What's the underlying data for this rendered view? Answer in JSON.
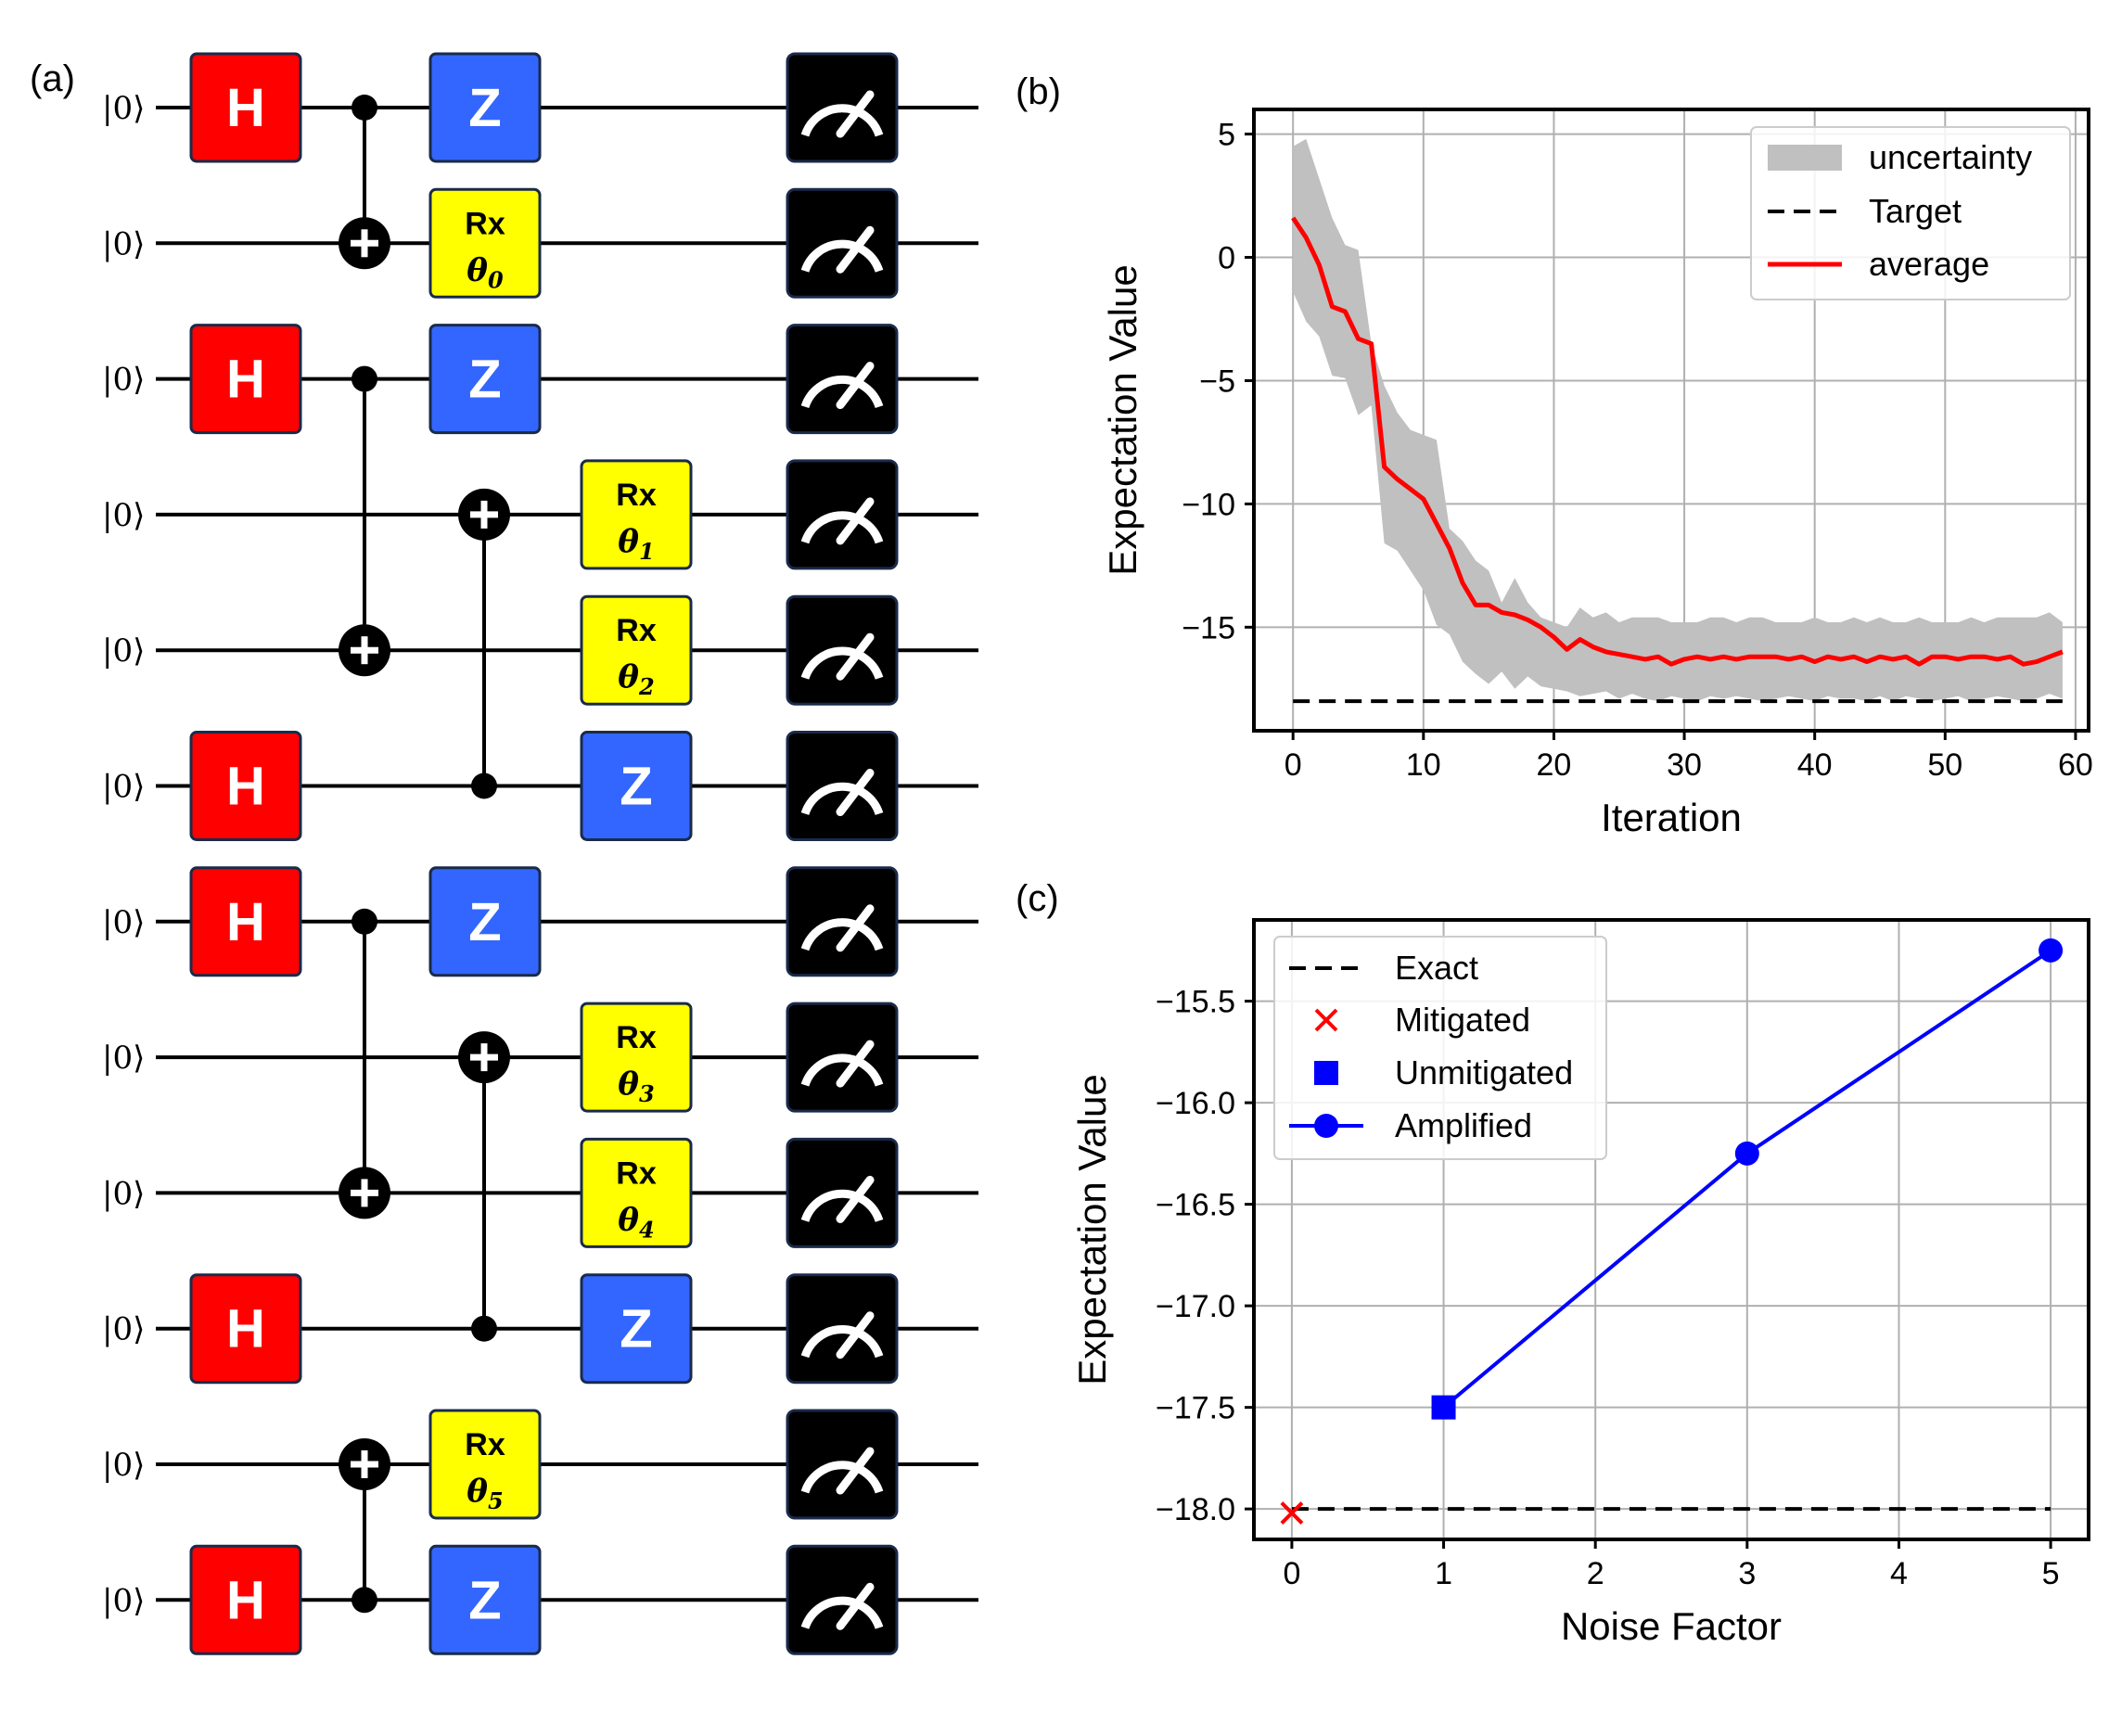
{
  "panels": {
    "a": "(a)",
    "b": "(b)",
    "c": "(c)"
  },
  "colors": {
    "h_gate": "#ff0000",
    "z_gate": "#3366ff",
    "rx_gate": "#ffff00",
    "measure": "#000000",
    "gate_border": "#1a2a4a",
    "uncertainty": "#c0c0c0",
    "average": "#ff0000",
    "target": "#000000",
    "amplified": "#0000ff",
    "mitigated": "#ff0000",
    "unmitigated": "#0000ff"
  },
  "circuit": {
    "ket_label": "|0⟩",
    "qubits": 12,
    "h_label": "H",
    "z_label": "Z",
    "rx_label": "Rx",
    "theta_symbol": "θ",
    "theta_indices": [
      "0",
      "1",
      "2",
      "3",
      "4",
      "5"
    ],
    "h_rows": [
      0,
      2,
      5,
      6,
      9,
      11
    ],
    "z_rows": [
      0,
      2,
      5,
      6,
      9,
      11
    ],
    "rx_gates": [
      {
        "row": 1,
        "theta": 0
      },
      {
        "row": 3,
        "theta": 1
      },
      {
        "row": 4,
        "theta": 2
      },
      {
        "row": 7,
        "theta": 3
      },
      {
        "row": 8,
        "theta": 4
      },
      {
        "row": 10,
        "theta": 5
      }
    ],
    "cnots": [
      {
        "control": 0,
        "target": 1,
        "column": 1
      },
      {
        "control": 2,
        "target": 4,
        "column": 1
      },
      {
        "control": 5,
        "target": 3,
        "column": 2
      },
      {
        "control": 6,
        "target": 8,
        "column": 1
      },
      {
        "control": 9,
        "target": 7,
        "column": 2
      },
      {
        "control": 11,
        "target": 10,
        "column": 1
      }
    ],
    "measure_icon": "meter-icon"
  },
  "chart_data": [
    {
      "panel": "(b)",
      "type": "line",
      "xlabel": "Iteration",
      "ylabel": "Expectation Value",
      "xlim": [
        -3,
        61
      ],
      "ylim": [
        -19.2,
        6
      ],
      "xticks": [
        0,
        10,
        20,
        30,
        40,
        50,
        60
      ],
      "yticks": [
        5,
        0,
        -5,
        -10,
        -15
      ],
      "xtick_labels": [
        "0",
        "10",
        "20",
        "30",
        "40",
        "50",
        "60"
      ],
      "ytick_labels": [
        "5",
        "0",
        "−5",
        "−10",
        "−15"
      ],
      "grid": true,
      "legend_position": "upper-right",
      "series": [
        {
          "name": "uncertainty",
          "kind": "band",
          "x": [
            0,
            1,
            2,
            3,
            4,
            5,
            6,
            7,
            8,
            9,
            10,
            11,
            12,
            13,
            14,
            15,
            16,
            17,
            18,
            19,
            20,
            21,
            22,
            23,
            24,
            25,
            26,
            27,
            28,
            29,
            30,
            31,
            32,
            33,
            34,
            35,
            36,
            37,
            38,
            39,
            40,
            41,
            42,
            43,
            44,
            45,
            46,
            47,
            48,
            49,
            50,
            51,
            52,
            53,
            54,
            55,
            56,
            57,
            58,
            59
          ],
          "upper": [
            4.5,
            4.8,
            3.2,
            1.6,
            0.5,
            0.3,
            -3.5,
            -5.2,
            -6.3,
            -7.0,
            -7.2,
            -7.4,
            -11.0,
            -11.5,
            -12.3,
            -12.7,
            -14.0,
            -13.0,
            -14.0,
            -14.6,
            -14.8,
            -15.0,
            -14.2,
            -14.6,
            -14.4,
            -14.8,
            -14.6,
            -14.6,
            -14.6,
            -14.8,
            -14.8,
            -14.8,
            -14.6,
            -14.6,
            -14.8,
            -14.6,
            -14.6,
            -14.8,
            -14.8,
            -14.8,
            -14.6,
            -14.8,
            -14.8,
            -14.6,
            -14.8,
            -14.6,
            -14.8,
            -14.8,
            -14.6,
            -14.8,
            -14.8,
            -14.8,
            -14.6,
            -14.8,
            -14.6,
            -14.6,
            -14.6,
            -14.6,
            -14.4,
            -14.8
          ],
          "lower": [
            -1.4,
            -2.6,
            -3.2,
            -4.8,
            -4.9,
            -6.4,
            -6.0,
            -11.6,
            -11.9,
            -12.7,
            -13.5,
            -14.9,
            -15.3,
            -16.4,
            -16.9,
            -17.3,
            -16.8,
            -17.5,
            -17.0,
            -17.4,
            -17.5,
            -17.6,
            -17.8,
            -17.7,
            -17.6,
            -17.9,
            -17.7,
            -17.9,
            -18.0,
            -17.8,
            -17.9,
            -18.0,
            -17.8,
            -17.9,
            -17.8,
            -17.9,
            -18.0,
            -17.9,
            -17.8,
            -17.9,
            -18.0,
            -17.8,
            -17.9,
            -17.9,
            -18.0,
            -17.8,
            -18.0,
            -17.8,
            -17.9,
            -18.0,
            -17.9,
            -17.8,
            -18.0,
            -17.9,
            -17.8,
            -17.9,
            -18.0,
            -17.9,
            -17.7,
            -17.9
          ]
        },
        {
          "name": "Target",
          "kind": "hline",
          "y": -18.0,
          "x_range": [
            0,
            59
          ]
        },
        {
          "name": "average",
          "kind": "line",
          "x": [
            0,
            1,
            2,
            3,
            4,
            5,
            6,
            7,
            8,
            9,
            10,
            11,
            12,
            13,
            14,
            15,
            16,
            17,
            18,
            19,
            20,
            21,
            22,
            23,
            24,
            25,
            26,
            27,
            28,
            29,
            30,
            31,
            32,
            33,
            34,
            35,
            36,
            37,
            38,
            39,
            40,
            41,
            42,
            43,
            44,
            45,
            46,
            47,
            48,
            49,
            50,
            51,
            52,
            53,
            54,
            55,
            56,
            57,
            58,
            59
          ],
          "y": [
            1.6,
            0.8,
            -0.3,
            -2.0,
            -2.2,
            -3.3,
            -3.5,
            -8.5,
            -9.0,
            -9.4,
            -9.8,
            -10.8,
            -11.8,
            -13.2,
            -14.1,
            -14.1,
            -14.4,
            -14.5,
            -14.7,
            -15.0,
            -15.4,
            -15.9,
            -15.5,
            -15.8,
            -16.0,
            -16.1,
            -16.2,
            -16.3,
            -16.2,
            -16.5,
            -16.3,
            -16.2,
            -16.3,
            -16.2,
            -16.3,
            -16.2,
            -16.2,
            -16.2,
            -16.3,
            -16.2,
            -16.4,
            -16.2,
            -16.3,
            -16.2,
            -16.4,
            -16.2,
            -16.3,
            -16.2,
            -16.5,
            -16.2,
            -16.2,
            -16.3,
            -16.2,
            -16.2,
            -16.3,
            -16.2,
            -16.5,
            -16.4,
            -16.2,
            -16.0
          ]
        }
      ]
    },
    {
      "panel": "(c)",
      "type": "line",
      "xlabel": "Noise Factor",
      "ylabel": "Expectation Value",
      "xlim": [
        -0.25,
        5.25
      ],
      "ylim": [
        -18.15,
        -15.1
      ],
      "xticks": [
        0,
        1,
        2,
        3,
        4,
        5
      ],
      "yticks": [
        -15.5,
        -16.0,
        -16.5,
        -17.0,
        -17.5,
        -18.0
      ],
      "xtick_labels": [
        "0",
        "1",
        "2",
        "3",
        "4",
        "5"
      ],
      "ytick_labels": [
        "−15.5",
        "−16.0",
        "−16.5",
        "−17.0",
        "−17.5",
        "−18.0"
      ],
      "grid": true,
      "legend_position": "upper-left",
      "series": [
        {
          "name": "Exact",
          "kind": "hline",
          "y": -18.0,
          "x_range": [
            0,
            5
          ]
        },
        {
          "name": "Mitigated",
          "kind": "scatter",
          "marker": "x",
          "x": [
            0
          ],
          "y": [
            -18.02
          ]
        },
        {
          "name": "Unmitigated",
          "kind": "scatter",
          "marker": "square",
          "x": [
            1
          ],
          "y": [
            -17.5
          ]
        },
        {
          "name": "Amplified",
          "kind": "line-marker",
          "x": [
            1,
            3,
            5
          ],
          "y": [
            -17.5,
            -16.25,
            -15.25
          ]
        }
      ]
    }
  ]
}
